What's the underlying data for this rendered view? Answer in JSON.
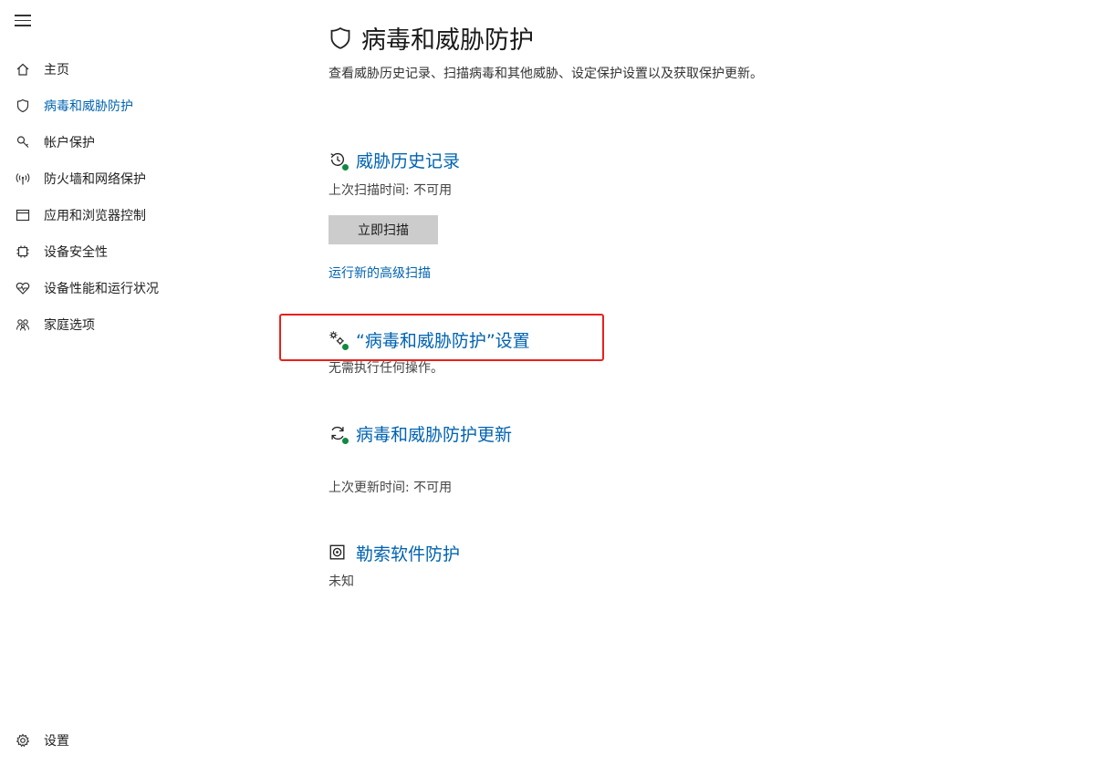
{
  "sidebar": {
    "items": [
      {
        "label": "主页",
        "icon": "home-icon"
      },
      {
        "label": "病毒和威胁防护",
        "icon": "shield-icon",
        "active": true
      },
      {
        "label": "帐户保护",
        "icon": "person-key-icon"
      },
      {
        "label": "防火墙和网络保护",
        "icon": "wifi-antenna-icon"
      },
      {
        "label": "应用和浏览器控制",
        "icon": "browser-window-icon"
      },
      {
        "label": "设备安全性",
        "icon": "chip-icon"
      },
      {
        "label": "设备性能和运行状况",
        "icon": "heart-pulse-icon"
      },
      {
        "label": "家庭选项",
        "icon": "family-icon"
      }
    ],
    "settings_label": "设置"
  },
  "main": {
    "title": "病毒和威胁防护",
    "description": "查看威胁历史记录、扫描病毒和其他威胁、设定保护设置以及获取保护更新。",
    "history": {
      "title": "威胁历史记录",
      "last_scan": "上次扫描时间: 不可用",
      "scan_button": "立即扫描",
      "advanced_link": "运行新的高级扫描"
    },
    "settings": {
      "title": "“病毒和威胁防护”设置",
      "text": "无需执行任何操作。"
    },
    "updates": {
      "title": "病毒和威胁防护更新",
      "last_update": "上次更新时间: 不可用"
    },
    "ransomware": {
      "title": "勒索软件防护",
      "status": "未知"
    }
  },
  "colors": {
    "accent": "#0063b1",
    "status_ok": "#10893e",
    "highlight": "#e8201c",
    "button_bg": "#cccccc"
  }
}
